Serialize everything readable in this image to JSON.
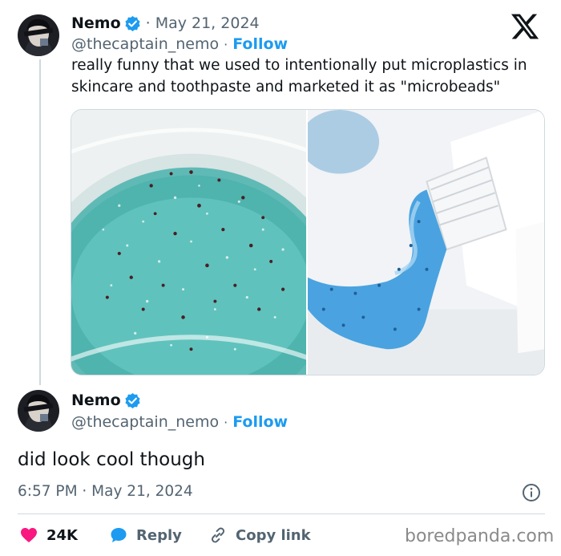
{
  "tweet": {
    "author_name": "Nemo",
    "handle": "@thecaptain_nemo",
    "separator": "·",
    "follow_label": "Follow",
    "date": "May 21, 2024",
    "text": "really funny that we used to intentionally put microplastics in skincare and toothpaste and marketed it as \"microbeads\"",
    "media": [
      "microbead-gel-image",
      "toothpaste-tube-image"
    ]
  },
  "reply": {
    "author_name": "Nemo",
    "handle": "@thecaptain_nemo",
    "separator": "·",
    "follow_label": "Follow",
    "text": "did look cool though",
    "timestamp": "6:57 PM · May 21, 2024"
  },
  "actions": {
    "like_count": "24K",
    "reply_label": "Reply",
    "copy_link_label": "Copy link"
  },
  "watermark": "boredpanda.com",
  "icons": [
    "verified-badge-icon",
    "x-logo-icon",
    "info-icon",
    "heart-icon",
    "reply-bubble-icon",
    "link-icon"
  ],
  "colors": {
    "accent": "#1d9bf0",
    "like": "#f91880",
    "text": "#0f1419",
    "muted": "#536471"
  }
}
